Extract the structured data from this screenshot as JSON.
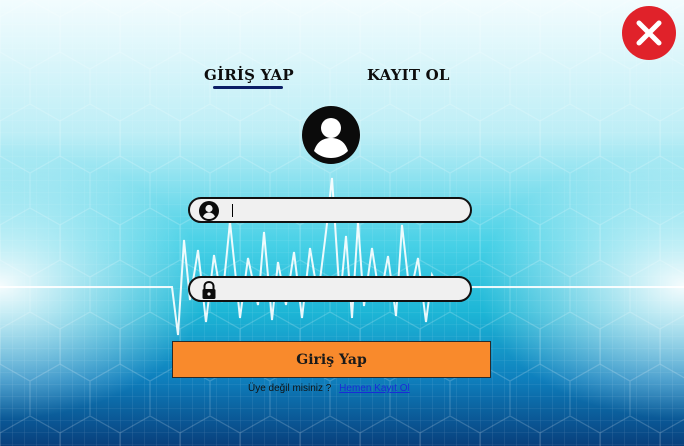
{
  "tabs": {
    "login": "GİRİŞ YAP",
    "register": "KAYIT OL",
    "active": "login"
  },
  "form": {
    "username": {
      "value": "",
      "placeholder": "",
      "icon": "user-icon"
    },
    "password": {
      "value": "",
      "placeholder": "",
      "icon": "lock-icon"
    },
    "submit_label": "Giriş Yap"
  },
  "footer": {
    "prompt": "Üye değil misiniz ?",
    "link": "Hemen Kayıt Ol"
  },
  "icons": {
    "avatar": "account-circle-icon",
    "close": "close-icon"
  },
  "colors": {
    "button": "#f98a2c",
    "close": "#e0222a",
    "link": "#1a2bd6",
    "tab_underline": "#0b1f66",
    "background_light": "#d8f6fb",
    "background_mid": "#2fc6de",
    "background_dark": "#0a5d9c"
  }
}
